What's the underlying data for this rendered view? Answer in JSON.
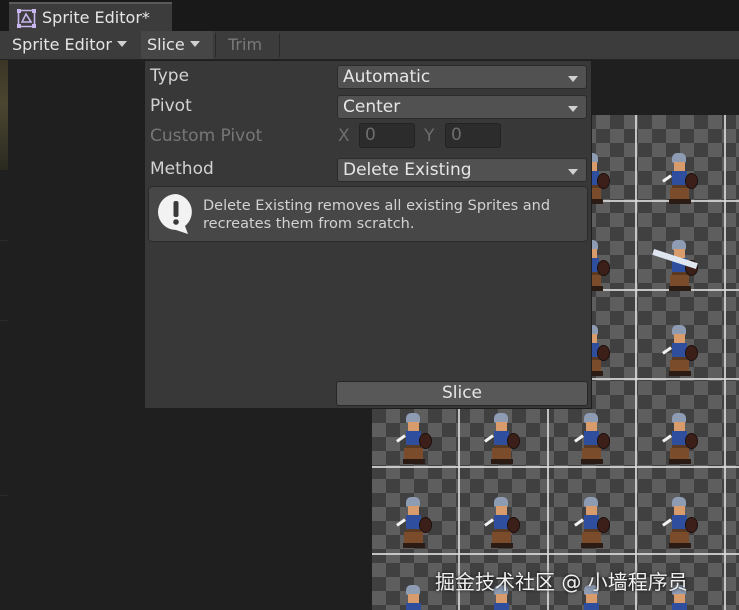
{
  "window": {
    "tab_title": "Sprite Editor*",
    "tab_icon": "sprite-editor-icon"
  },
  "toolbar": {
    "sprite_editor_label": "Sprite Editor",
    "slice_label": "Slice",
    "trim_label": "Trim"
  },
  "slice_panel": {
    "type_label": "Type",
    "type_value": "Automatic",
    "pivot_label": "Pivot",
    "pivot_value": "Center",
    "custom_pivot_label": "Custom Pivot",
    "x_label": "X",
    "x_value": "0",
    "y_label": "Y",
    "y_value": "0",
    "method_label": "Method",
    "method_value": "Delete Existing",
    "help_text": "Delete Existing removes all existing Sprites and recreates them from scratch.",
    "slice_button": "Slice"
  },
  "watermark": "掘金技术社区 @ 小墙程序员",
  "colors": {
    "panel_bg": "#383838",
    "toolbar_bg": "#3c3c3c",
    "dropdown_bg": "#515151",
    "text": "#d2d2d2",
    "checker_light": "#5e5e5e",
    "checker_dark": "#404040"
  }
}
